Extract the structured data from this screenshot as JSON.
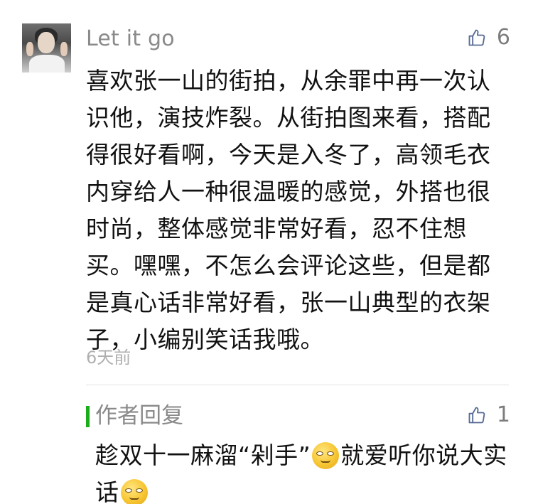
{
  "comment": {
    "username": "Let it go",
    "like_count": "6",
    "text": "喜欢张一山的街拍，从余罪中再一次认识他，演技炸裂。从街拍图来看，搭配得很好看啊，今天是入冬了，高领毛衣内穿给人一种很温暖的感觉，外搭也很时尚，整体感觉非常好看，忍不住想买。嘿嘿，不怎么会评论这些，但是都是真心话非常好看，张一山典型的衣架子，小编别笑话我哦。",
    "time": "6天前"
  },
  "reply": {
    "label": "作者回复",
    "like_count": "1",
    "text_part1": "趁双十一麻溜“剁手”",
    "text_part2": "就爱听你说大实话"
  },
  "icons": {
    "like": "thumbs-up-icon",
    "emoji1": "smirk-emoji-icon",
    "emoji2": "thinking-emoji-icon"
  },
  "colors": {
    "accent_green": "#1aad19",
    "icon_blue": "#576b95",
    "secondary_text": "#8a8a8a"
  }
}
